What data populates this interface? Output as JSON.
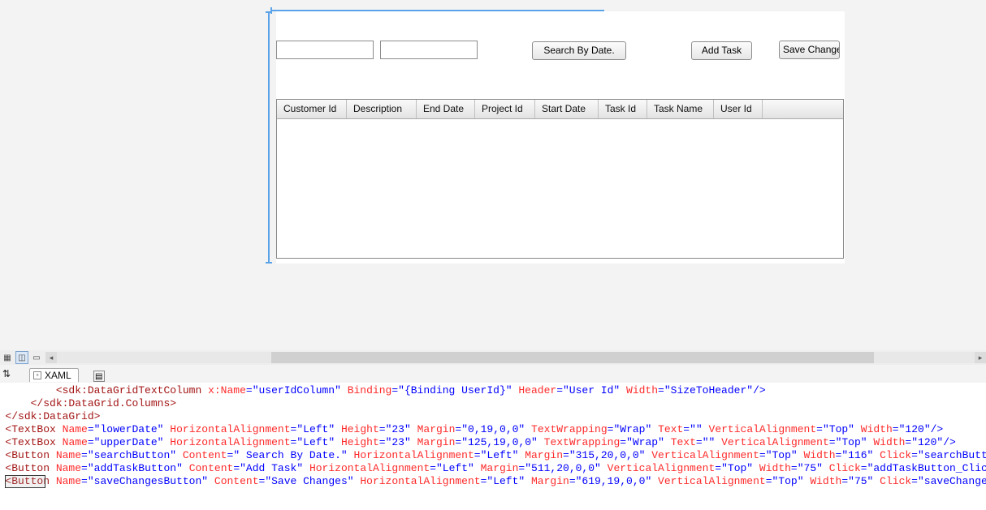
{
  "designer": {
    "textboxes": {
      "lowerDate": {
        "value": "",
        "placeholder": ""
      },
      "upperDate": {
        "value": "",
        "placeholder": ""
      }
    },
    "buttons": {
      "search_label": " Search By Date.",
      "addTask_label": "Add Task",
      "saveChanges_label": "Save Changes"
    },
    "grid": {
      "headers": {
        "customerId": "Customer Id",
        "description": "Description",
        "endDate": "End Date",
        "projectId": "Project Id",
        "startDate": "Start Date",
        "taskId": "Task Id",
        "taskName": "Task Name",
        "userId": "User Id"
      }
    }
  },
  "tabs": {
    "xaml_label": "XAML"
  },
  "sync_glyph": "⇅",
  "xaml_code": {
    "l1_a": "<sdk:DataGridTextColumn",
    "l1_xname": " x:Name",
    "l1_xname_v": "\"userIdColumn\"",
    "l1_bind": " Binding",
    "l1_bind_v": "\"{Binding UserId}\"",
    "l1_hdr": " Header",
    "l1_hdr_v": "\"User Id\"",
    "l1_w": " Width",
    "l1_w_v": "\"SizeToHeader\"",
    "l1_end": "/>",
    "l2": "</sdk:DataGrid.Columns>",
    "l3": "</sdk:DataGrid>",
    "tb_tag": "<TextBox",
    "btn_tag": "<Button",
    "name_attr": " Name",
    "lower_name": "\"lowerDate\"",
    "upper_name": "\"upperDate\"",
    "search_name": "\"searchButton\"",
    "add_name": "\"addTaskButton\"",
    "save_name": "\"saveChangesButton\"",
    "ha_attr": " HorizontalAlignment",
    "ha_v": "\"Left\"",
    "h_attr": " Height",
    "h_v": "\"23\"",
    "m_attr": " Margin",
    "m_lower": "\"0,19,0,0\"",
    "m_upper": "\"125,19,0,0\"",
    "m_search": "\"315,20,0,0\"",
    "m_add": "\"511,20,0,0\"",
    "m_save": "\"619,19,0,0\"",
    "tw_attr": " TextWrapping",
    "tw_v": "\"Wrap\"",
    "text_attr": " Text",
    "text_v": "\"\"",
    "va_attr": " VerticalAlignment",
    "va_v": "\"Top\"",
    "w_attr": " Width",
    "w120": "\"120\"",
    "w116": "\"116\"",
    "w75": "\"75\"",
    "content_attr": " Content",
    "content_search": "\" Search By Date.\"",
    "content_add": "\"Add Task\"",
    "content_save": "\"Save Changes\"",
    "click_attr": " Click",
    "click_search": "\"searchButton_Click\"",
    "click_add": "\"addTaskButton_Click\"",
    "click_save": "\"saveChangesButton_Click\"",
    "tag_close": "/>",
    "trail": "rid>"
  }
}
